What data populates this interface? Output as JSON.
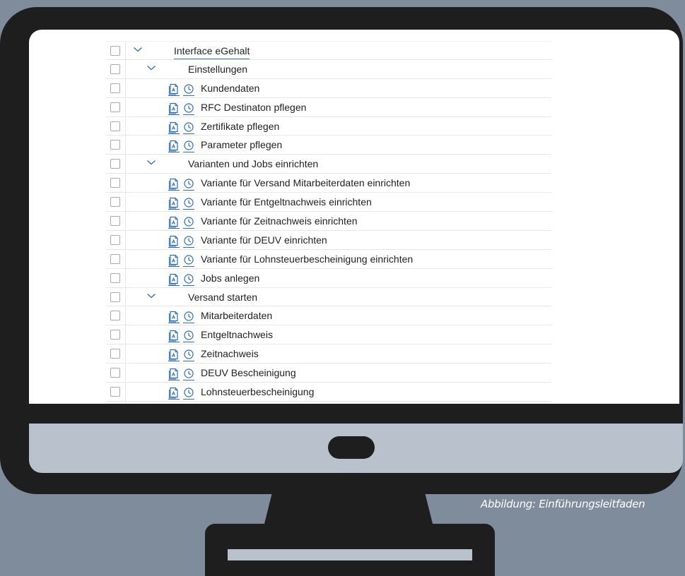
{
  "caption": "Abbildung: Einführungsleitfaden",
  "tree": {
    "root": {
      "label": "Interface eGehalt"
    },
    "groups": [
      {
        "label": "Einstellungen",
        "items": [
          "Kundendaten",
          "RFC Destinaton pflegen",
          "Zertifikate pflegen",
          "Parameter pflegen"
        ]
      },
      {
        "label": "Varianten und Jobs einrichten",
        "items": [
          "Variante für Versand Mitarbeiterdaten einrichten",
          "Variante für Entgeltnachweis einrichten",
          "Variante für Zeitnachweis einrichten",
          "Variante für DEUV einrichten",
          "Variante für Lohnsteuerbescheinigung einrichten",
          "Jobs anlegen"
        ]
      },
      {
        "label": "Versand starten",
        "items": [
          "Mitarbeiterdaten",
          "Entgeltnachweis",
          "Zeitnachweis",
          "DEUV Bescheinigung",
          "Lohnsteuerbescheinigung"
        ]
      }
    ]
  },
  "icons": {
    "activity": "documentation-icon",
    "status": "clock-status-icon",
    "expand": "chevron-down-icon"
  },
  "colors": {
    "accent": "#2d6db5",
    "background": "#7e8c9c",
    "frame": "#1e1e1e",
    "chin": "#b8c1cc"
  }
}
